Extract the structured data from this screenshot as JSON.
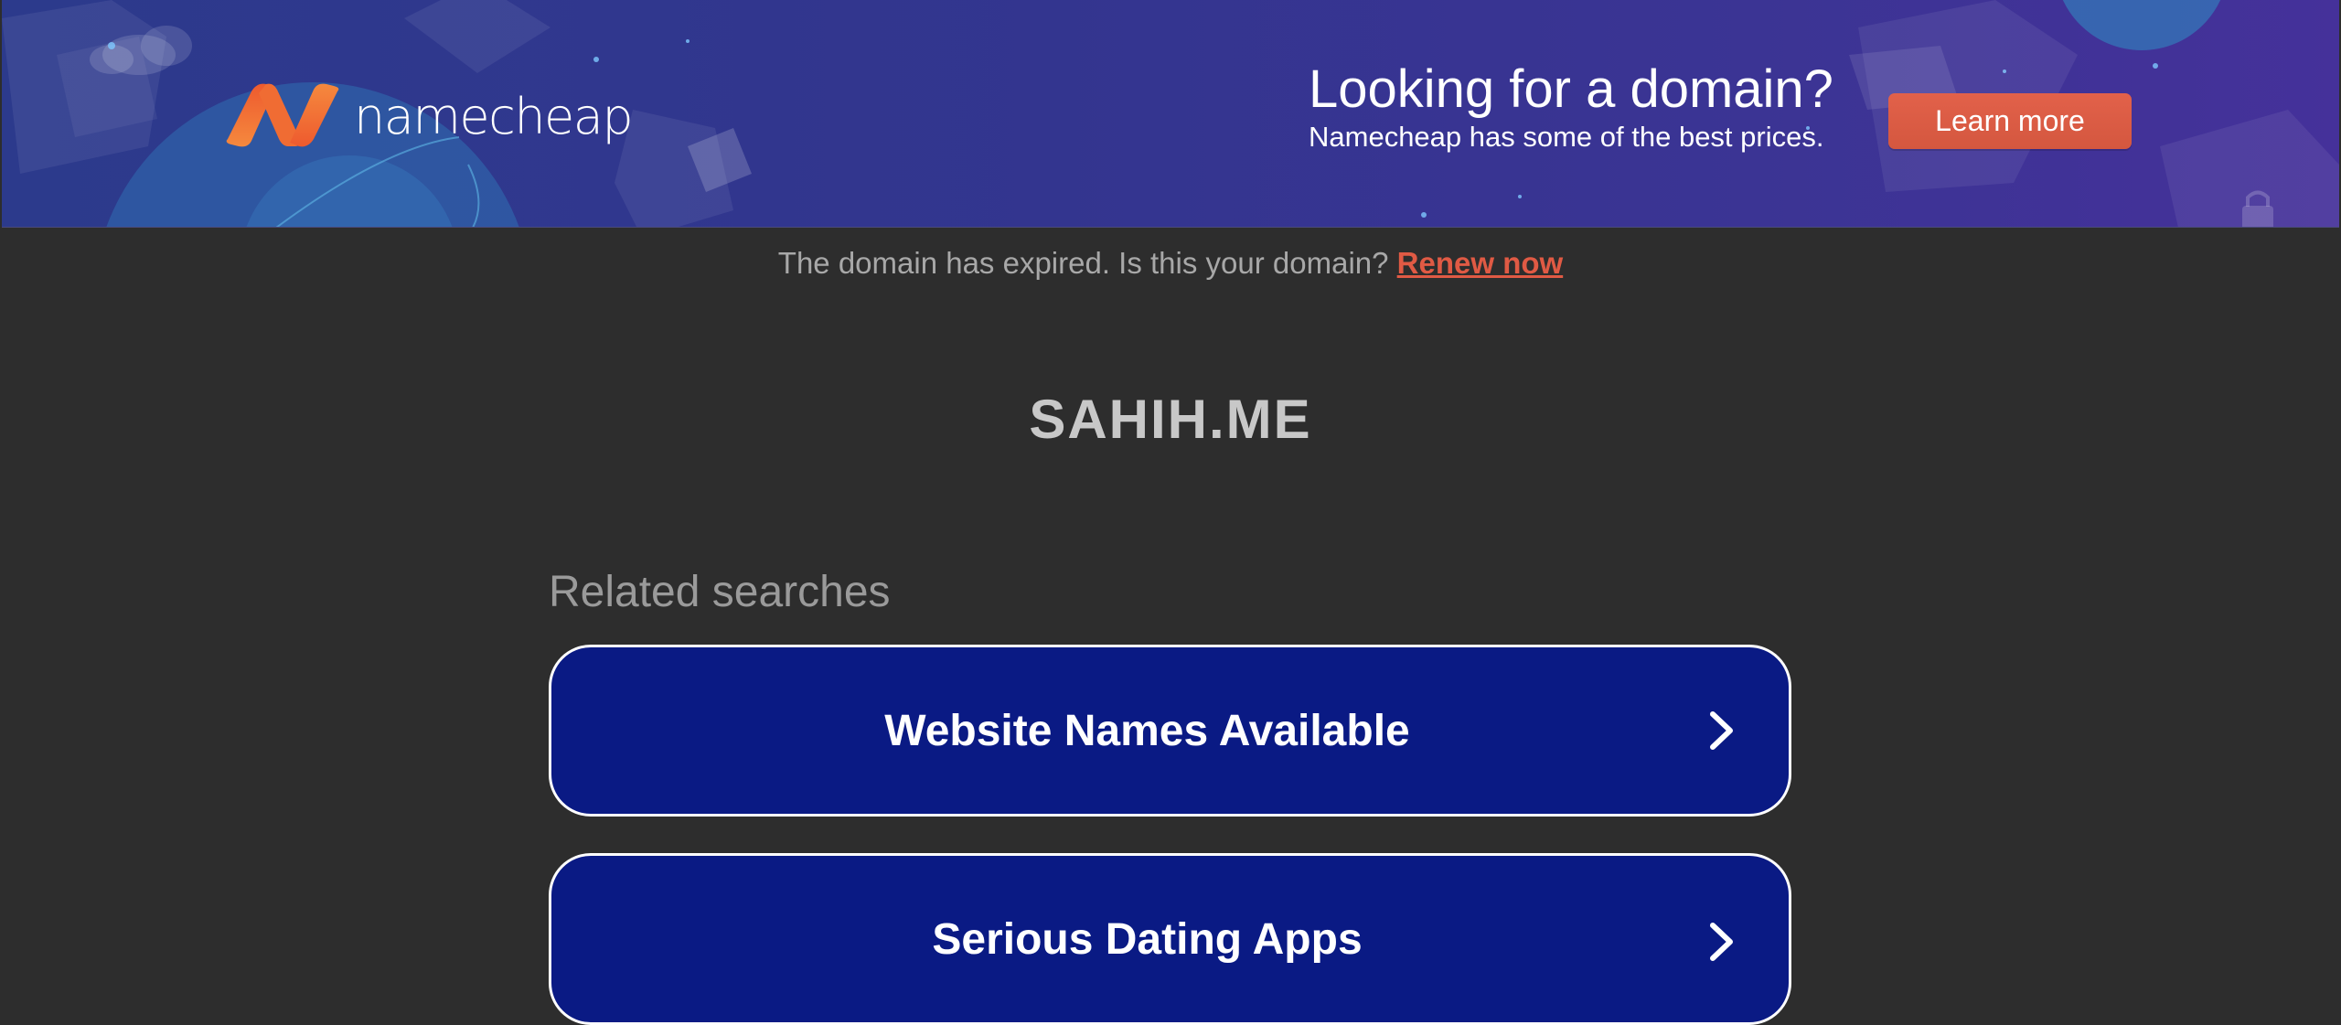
{
  "banner": {
    "brand_name": "namecheap",
    "logo_icon": "namecheap-n-logo",
    "promo_title": "Looking for a domain?",
    "promo_subtitle": "Namecheap has some of the best prices.",
    "cta_label": "Learn more",
    "colors": {
      "background_start": "#2c3a8c",
      "background_end": "#45319a",
      "logo_orange": "#f26a3b",
      "cta": "#e05a44"
    }
  },
  "notice": {
    "text": "The domain has expired. Is this your domain?",
    "link_label": "Renew now",
    "link_color": "#e05a44"
  },
  "domain": {
    "name": "SAHIH.ME"
  },
  "related": {
    "heading": "Related searches",
    "items": [
      {
        "label": "Website Names Available",
        "icon": "chevron-right-icon"
      },
      {
        "label": "Serious Dating Apps",
        "icon": "chevron-right-icon"
      }
    ],
    "card_color": "#0a1a84"
  }
}
